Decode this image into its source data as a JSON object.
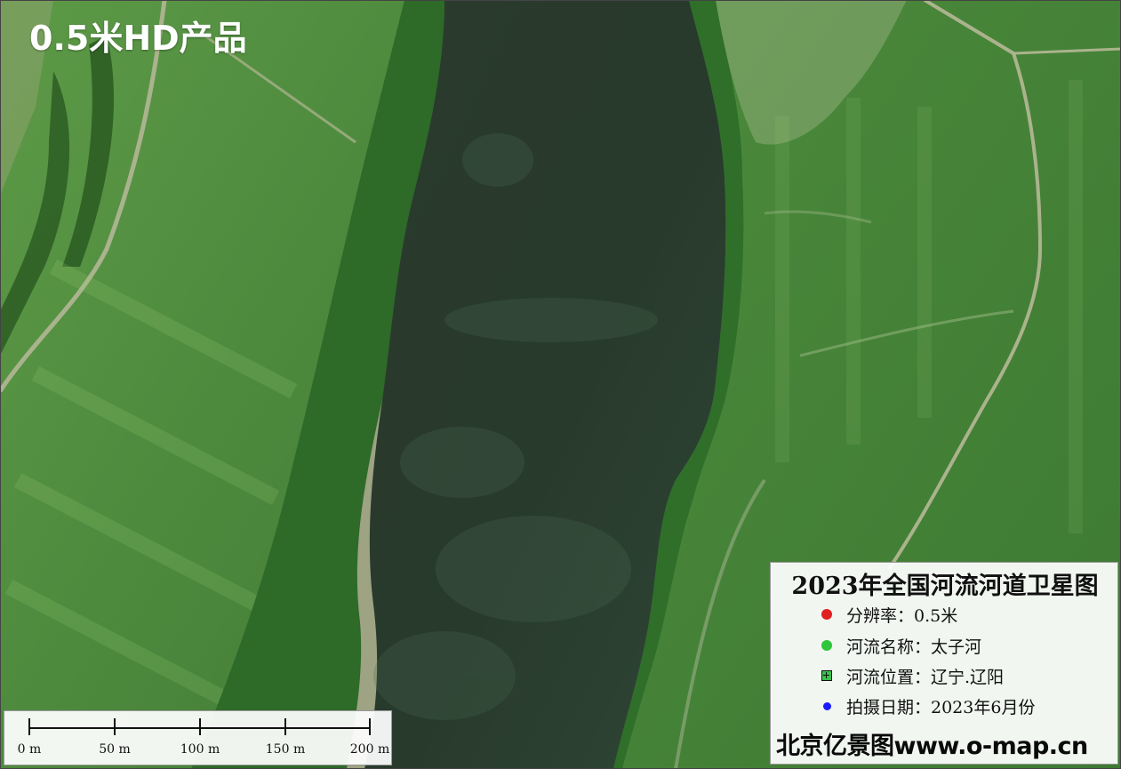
{
  "badge": {
    "text": "0.5米HD产品"
  },
  "legend": {
    "title": "2023年全国河流河道卫星图",
    "rows": [
      {
        "symbol": "red-dot-icon",
        "color": "#e02020",
        "text": "分辨率：0.5米"
      },
      {
        "symbol": "green-dot-icon",
        "color": "#2ec63a",
        "text": "河流名称：太子河"
      },
      {
        "symbol": "green-square-icon",
        "color": "#39c24a",
        "text": "河流位置：辽宁.辽阳"
      },
      {
        "symbol": "blue-dot-icon",
        "color": "#1a1aff",
        "text": "拍摄日期：2023年6月份"
      }
    ],
    "credit": "北京亿景图www.o-map.cn"
  },
  "scale_bar": {
    "labels": [
      "0 m",
      "50 m",
      "100 m",
      "150 m",
      "200 m"
    ]
  },
  "colors": {
    "river": "#283a2c",
    "field": "#4f8a3e",
    "trees": "#2f6b2a",
    "sandbank": "#b9b29a"
  }
}
